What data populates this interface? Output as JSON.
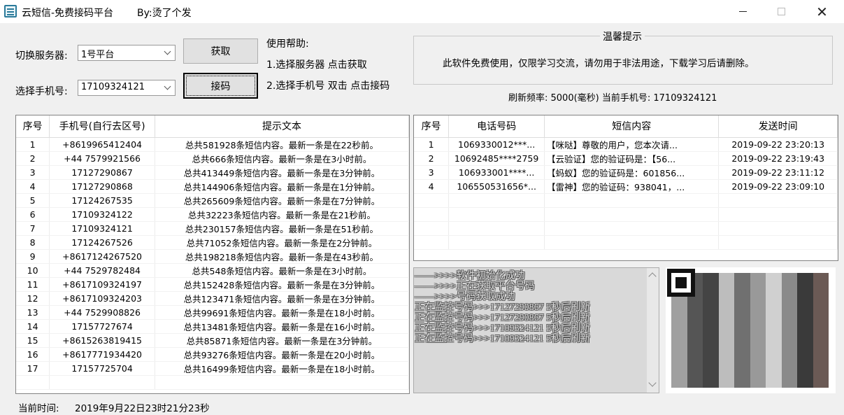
{
  "window": {
    "title": "云短信-免费接码平台",
    "author": "By:烫了个发"
  },
  "controls": {
    "server_label": "切换服务器:",
    "server_value": "1号平台",
    "phone_label": "选择手机号:",
    "phone_value": "17109324121",
    "fetch_button": "获取",
    "receive_button": "接码"
  },
  "help": {
    "title": "使用帮助:",
    "step1": "1.选择服务器 点击获取",
    "step2": "2.选择手机号 双击 点击接码"
  },
  "tips": {
    "title": "温馨提示",
    "text": "此软件免费使用，仅限学习交流，请勿用于非法用途，下载学习后请删除。"
  },
  "status": {
    "line": "刷新频率: 5000(毫秒)  当前手机号: 17109324121"
  },
  "phone_table": {
    "headers": [
      "序号",
      "手机号(自行去区号)",
      "提示文本"
    ],
    "rows": [
      [
        "1",
        "+8619965412404",
        "总共581928条短信内容。最新一条是在22秒前。"
      ],
      [
        "2",
        "+44 7579921566",
        "总共666条短信内容。最新一条是在3小时前。"
      ],
      [
        "3",
        "17127290867",
        "总共413449条短信内容。最新一条是在3分钟前。"
      ],
      [
        "4",
        "17127290868",
        "总共144906条短信内容。最新一条是在1分钟前。"
      ],
      [
        "5",
        "17124267535",
        "总共265609条短信内容。最新一条是在7分钟前。"
      ],
      [
        "6",
        "17109324122",
        "总共32223条短信内容。最新一条是在21秒前。"
      ],
      [
        "7",
        "17109324121",
        "总共230157条短信内容。最新一条是在51秒前。"
      ],
      [
        "8",
        "17124267526",
        "总共71052条短信内容。最新一条是在2分钟前。"
      ],
      [
        "9",
        "+8617124267520",
        "总共198218条短信内容。最新一条是在43秒前。"
      ],
      [
        "10",
        "+44 7529782484",
        "总共548条短信内容。最新一条是在3小时前。"
      ],
      [
        "11",
        "+8617109324197",
        "总共152428条短信内容。最新一条是在3分钟前。"
      ],
      [
        "12",
        "+8617109324203",
        "总共123471条短信内容。最新一条是在3分钟前。"
      ],
      [
        "13",
        "+44 7529908826",
        "总共99691条短信内容。最新一条是在18小时前。"
      ],
      [
        "14",
        "17157727674",
        "总共13481条短信内容。最新一条是在16小时前。"
      ],
      [
        "15",
        "+8615263819415",
        "总共85871条短信内容。最新一条是在3分钟前。"
      ],
      [
        "16",
        "+8617771934420",
        "总共93276条短信内容。最新一条是在20小时前。"
      ],
      [
        "17",
        "17157725704",
        "总共16499条短信内容。最新一条是在18小时前。"
      ]
    ]
  },
  "sms_table": {
    "headers": [
      "序号",
      "电话号码",
      "短信内容",
      "发送时间"
    ],
    "rows": [
      [
        "1",
        "1069330012***...",
        "【咪哒】尊敬的用户，您本次请...",
        "2019-09-22 23:20:13"
      ],
      [
        "2",
        "10692485****2759",
        "【云验证】您的验证码是：【56...",
        "2019-09-22 23:19:43"
      ],
      [
        "3",
        "106933001****...",
        "【蚂蚁】您的验证码是：601856...",
        "2019-09-22 23:11:12"
      ],
      [
        "4",
        "106550531656*...",
        "【雷神】您的验证码：938041，...",
        "2019-09-22 23:09:10"
      ]
    ]
  },
  "log": {
    "lines": [
      "——>>>>软件初始化成功",
      "——>>>>正在获取平台号码",
      "——>>>>号码获取成功",
      "正在监控号码>>>17127290867 5秒后刷新",
      "正在监控号码>>>17127290867 5秒后刷新",
      "正在监控号码>>>17109324121 5秒后刷新",
      "正在监控号码>>>17109324121 5秒后刷新"
    ]
  },
  "footer": {
    "label": "当前时间:",
    "value": "2019年9月22日23时21分23秒"
  },
  "icons": {
    "app": "sms-app-icon",
    "minimize": "minimize-icon",
    "maximize": "maximize-icon",
    "close": "close-icon",
    "dropdown": "chevron-down-icon",
    "qr": "qr-code-image"
  }
}
